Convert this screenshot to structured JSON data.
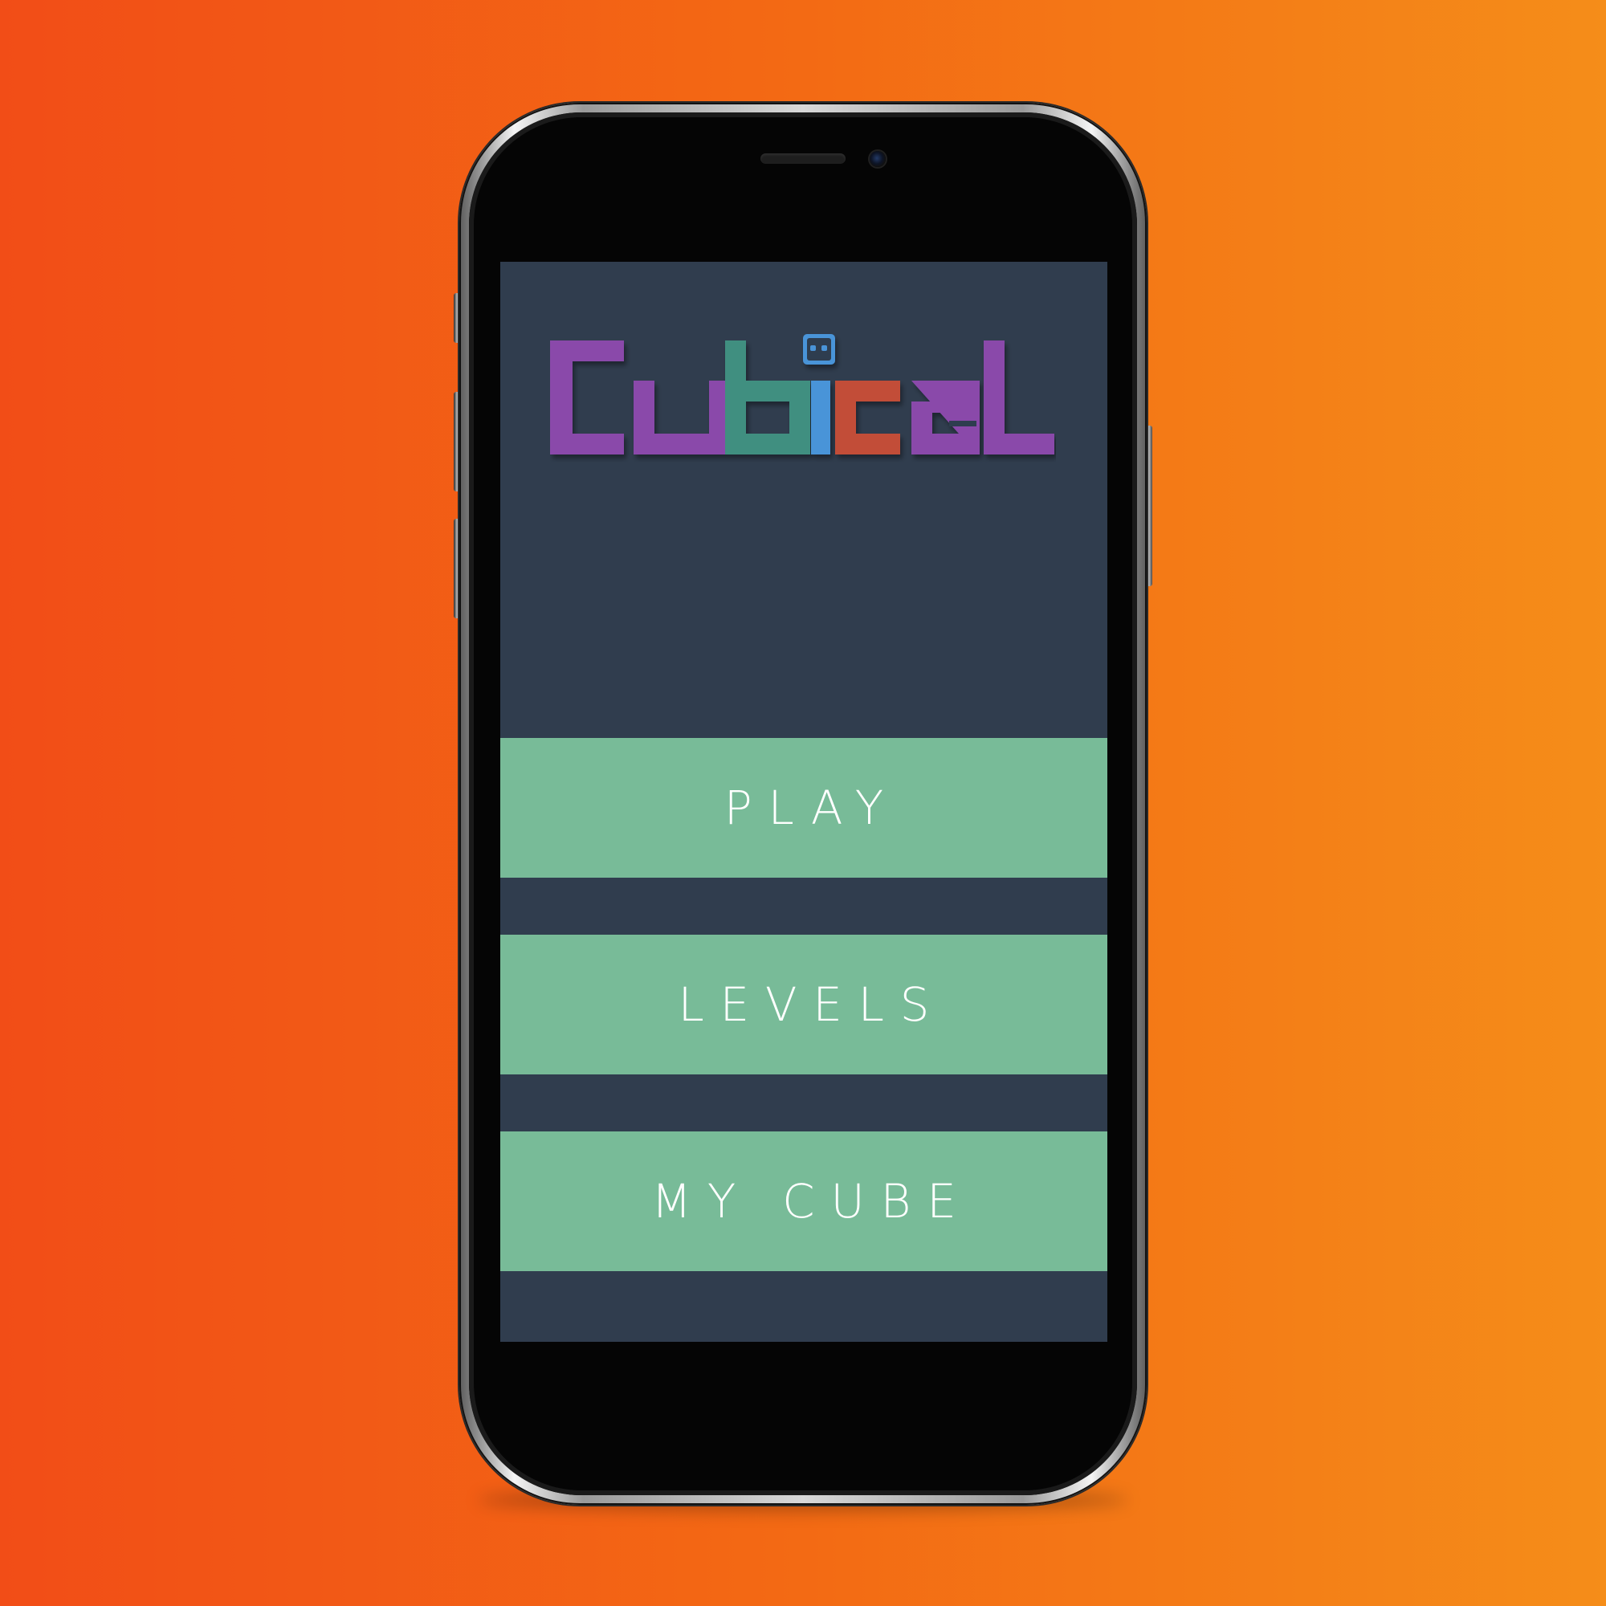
{
  "app": {
    "name": "Cubical",
    "logo_letters": [
      "C",
      "u",
      "b",
      "i",
      "c",
      "a",
      "l"
    ],
    "colors": {
      "background_gradient": [
        "#f24d17",
        "#f58d19"
      ],
      "screen_background": "#303d4e",
      "button_background": "#78bb98",
      "button_text": "#ffffff",
      "logo_purple": "#8a4aaa",
      "logo_teal": "#3f8f80",
      "logo_blue": "#4a94d8",
      "logo_red": "#c24d38"
    }
  },
  "menu": {
    "play_label": "PLAY",
    "levels_label": "LEVELS",
    "my_cube_label": "MY CUBE"
  },
  "icons": {
    "logo": "cubical-logo",
    "cube_character": "cube-character-icon",
    "speaker": "earpiece-speaker",
    "camera": "front-camera"
  }
}
